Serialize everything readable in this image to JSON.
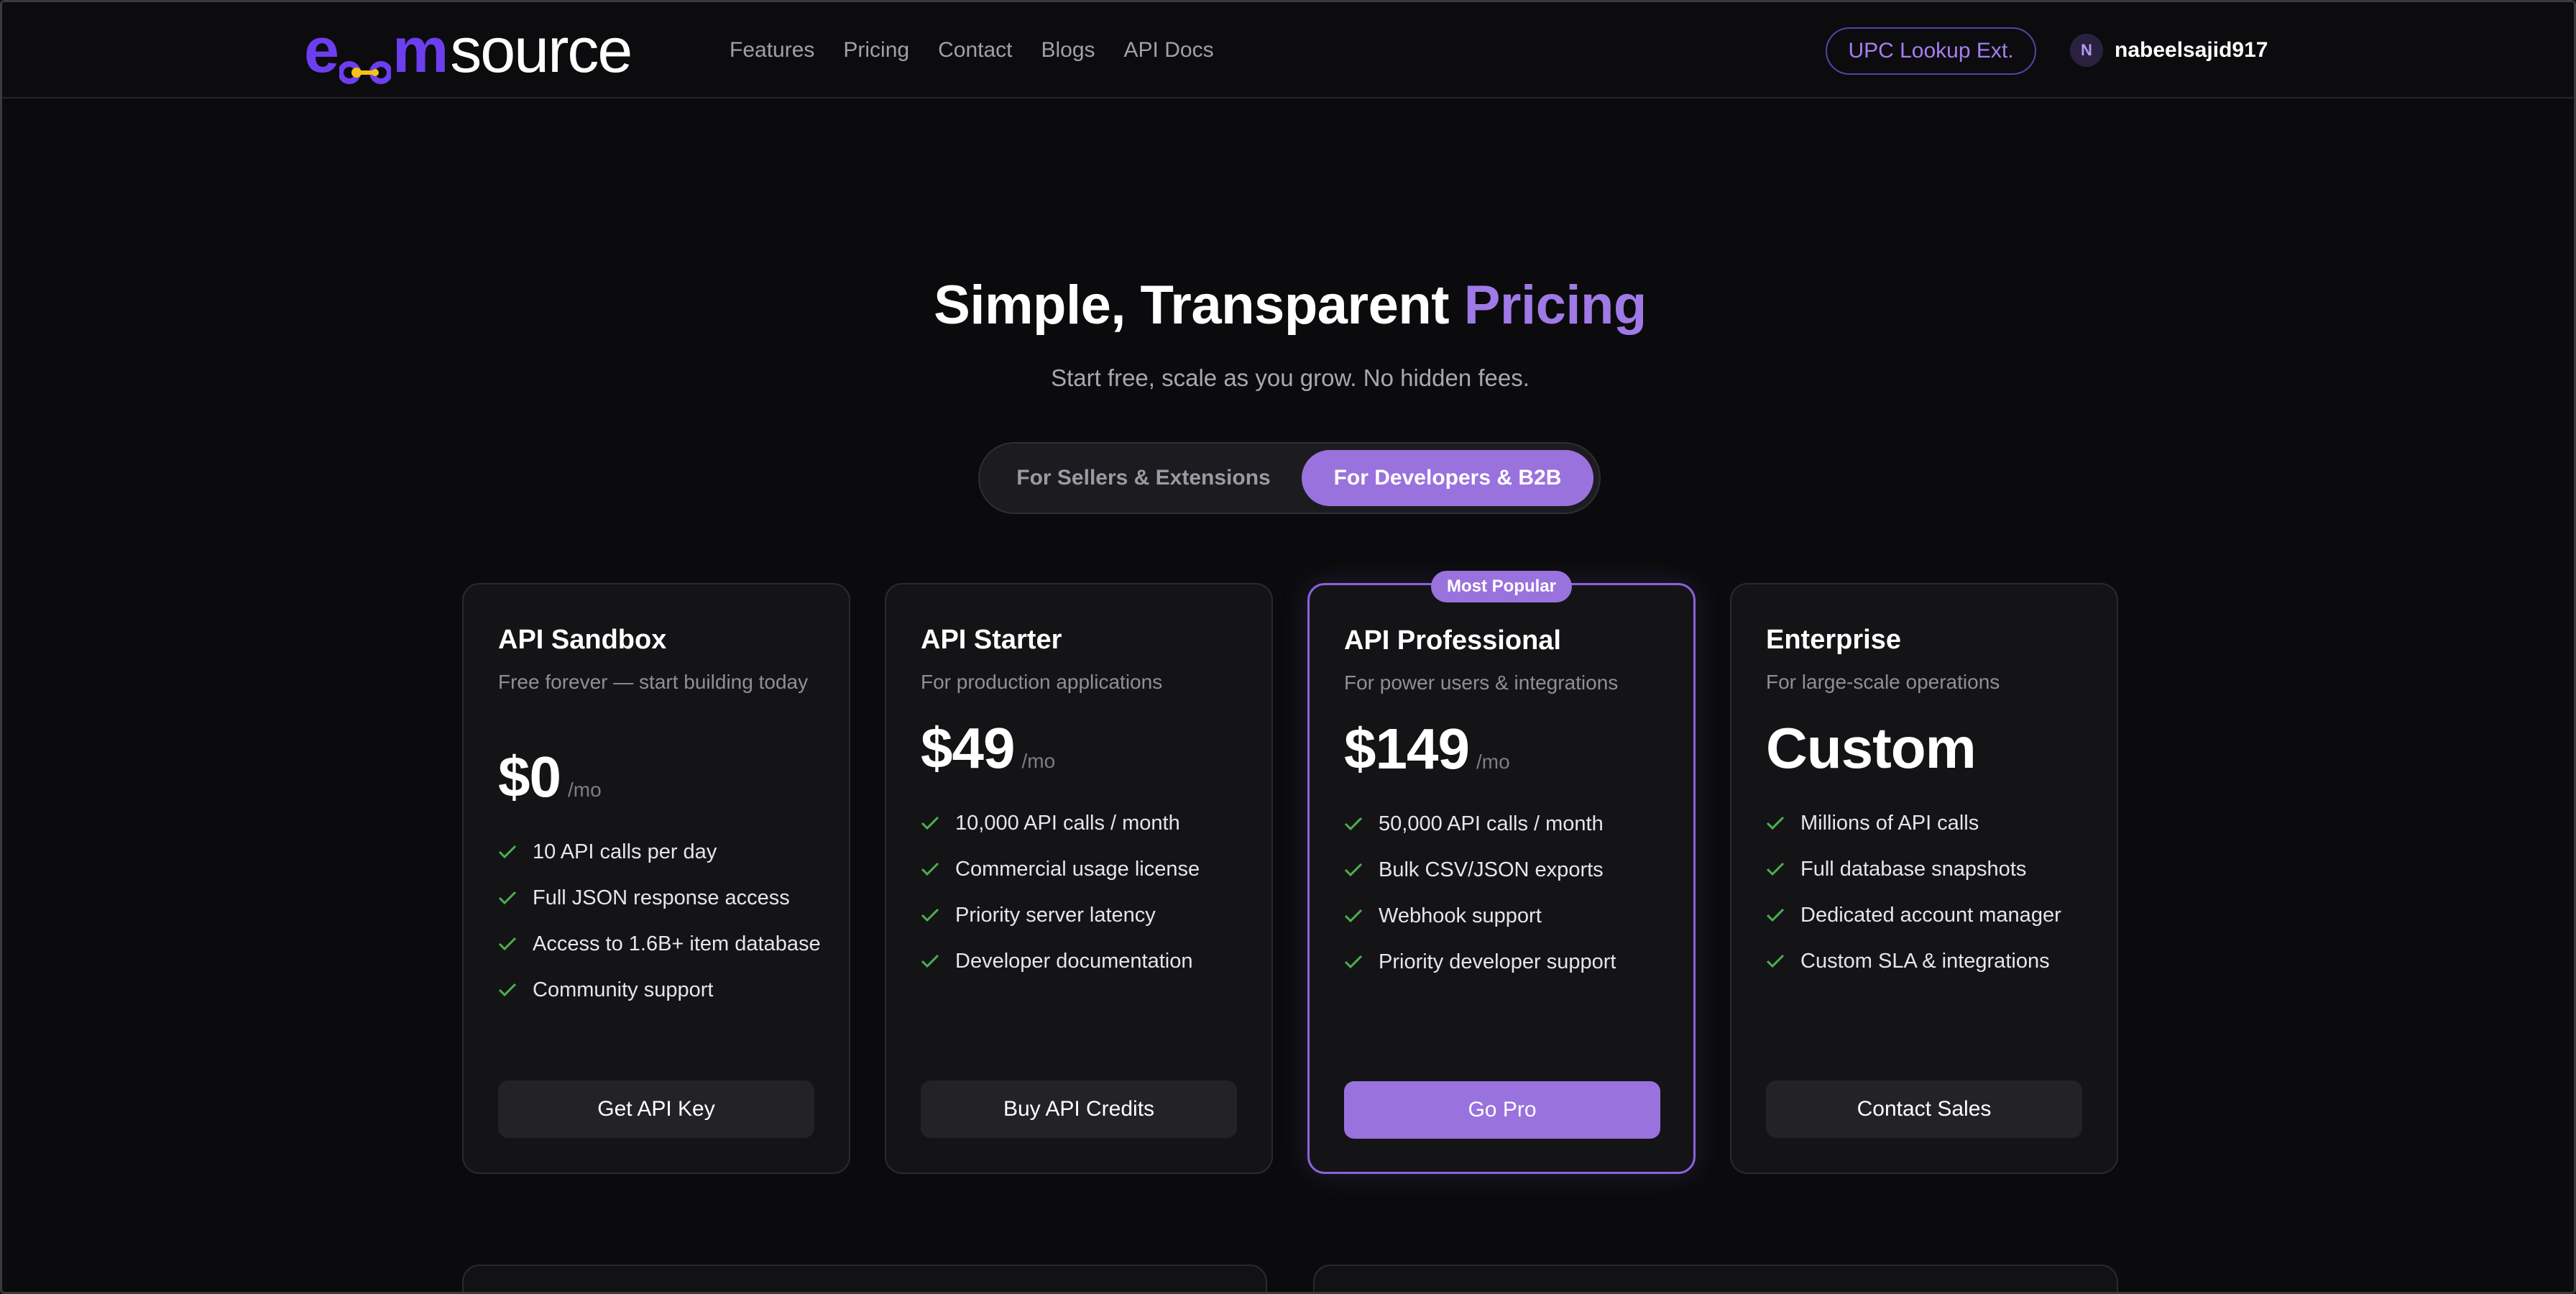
{
  "nav": {
    "logo": {
      "part1": "ecom",
      "part2": "source"
    },
    "links": [
      "Features",
      "Pricing",
      "Contact",
      "Blogs",
      "API Docs"
    ],
    "upc_button": "UPC Lookup Ext.",
    "user": {
      "initial": "N",
      "name": "nabeelsajid917"
    }
  },
  "hero": {
    "title_main": "Simple, Transparent ",
    "title_accent": "Pricing",
    "subtitle": "Start free, scale as you grow. No hidden fees."
  },
  "toggle": {
    "options": [
      "For Sellers & Extensions",
      "For Developers & B2B"
    ],
    "selected": "For Developers & B2B"
  },
  "plans": [
    {
      "name": "API Sandbox",
      "description": "Free forever — start building today",
      "price": "$0",
      "period": "/mo",
      "features": [
        "10 API calls per day",
        "Full JSON response access",
        "Access to 1.6B+ item database",
        "Community support"
      ],
      "cta": "Get API Key"
    },
    {
      "name": "API Starter",
      "description": "For production applications",
      "price": "$49",
      "period": "/mo",
      "features": [
        "10,000 API calls / month",
        "Commercial usage license",
        "Priority server latency",
        "Developer documentation"
      ],
      "cta": "Buy API Credits"
    },
    {
      "name": "API Professional",
      "badge": "Most Popular",
      "description": "For power users & integrations",
      "price": "$149",
      "period": "/mo",
      "features": [
        "50,000 API calls / month",
        "Bulk CSV/JSON exports",
        "Webhook support",
        "Priority developer support"
      ],
      "cta": "Go Pro"
    },
    {
      "name": "Enterprise",
      "description": "For large-scale operations",
      "price": "Custom",
      "period": "",
      "features": [
        "Millions of API calls",
        "Full database snapshots",
        "Dedicated account manager",
        "Custom SLA & integrations"
      ],
      "cta": "Contact Sales"
    }
  ],
  "colors": {
    "background": "#0b0b0d",
    "accent": "#9a72de",
    "logo_purple": "#6d3ef0",
    "check_green": "#4caf50"
  },
  "icons": {
    "check": "check-icon",
    "logo_link": "link-icon"
  }
}
